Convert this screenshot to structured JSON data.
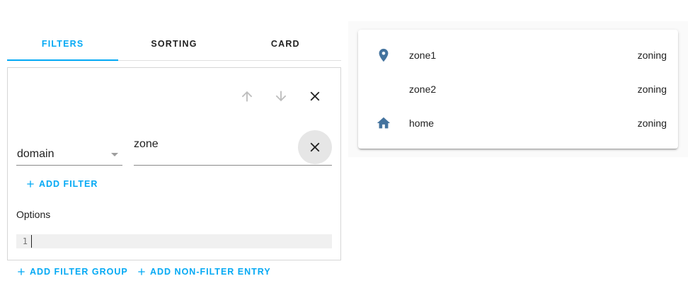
{
  "tabs": [
    {
      "label": "FILTERS",
      "active": true
    },
    {
      "label": "SORTING",
      "active": false
    },
    {
      "label": "CARD",
      "active": false
    }
  ],
  "filter_group": {
    "rule": {
      "attribute": "domain",
      "value": "zone"
    },
    "add_filter_label": "ADD FILTER",
    "options_label": "Options",
    "code_line_number": "1",
    "icons": {
      "move_up": "arrow-up-icon",
      "move_down": "arrow-down-icon",
      "remove_group": "close-icon",
      "clear_value": "close-icon"
    }
  },
  "actions": {
    "add_filter_group": "ADD FILTER GROUP",
    "add_non_filter_entry": "ADD NON-FILTER ENTRY"
  },
  "card": {
    "entities": [
      {
        "name": "zone1",
        "state": "zoning",
        "icon": "map-marker-icon"
      },
      {
        "name": "zone2",
        "state": "zoning",
        "icon": ""
      },
      {
        "name": "home",
        "state": "zoning",
        "icon": "home-icon"
      }
    ]
  },
  "colors": {
    "accent": "#03a9f4",
    "entity_icon": "#44739e",
    "disabled_icon": "#bdbdbd"
  }
}
